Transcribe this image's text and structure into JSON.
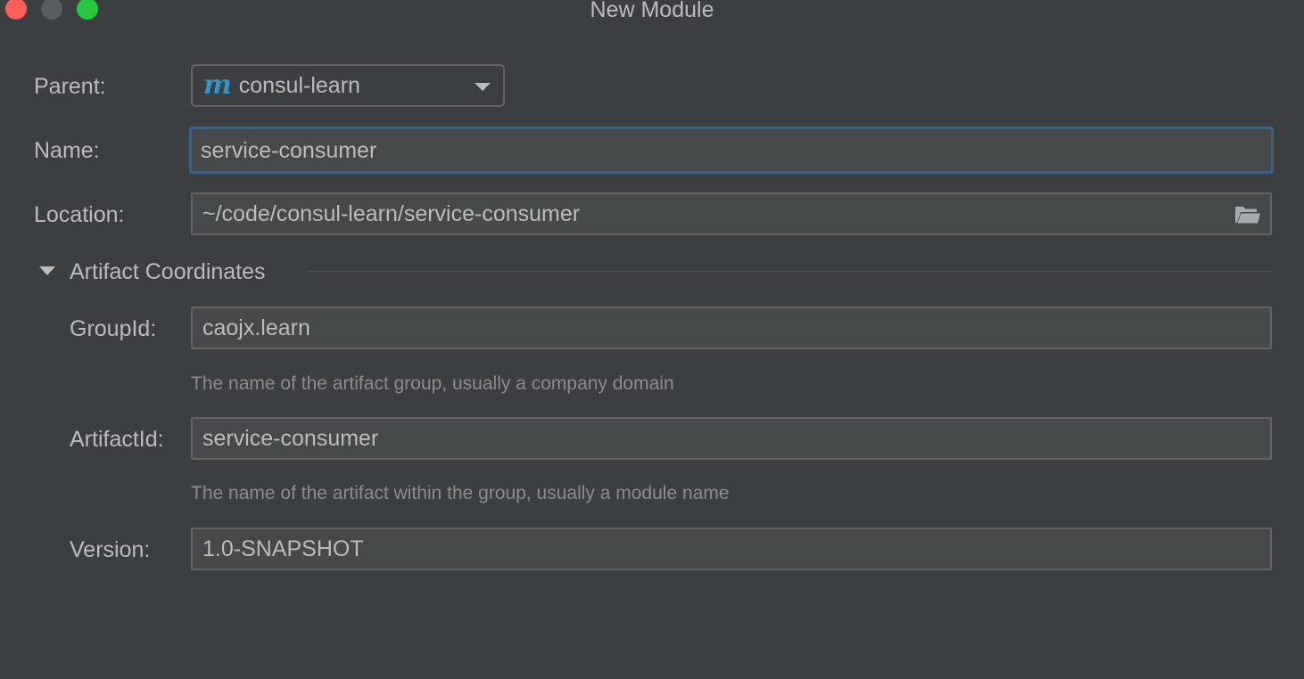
{
  "window": {
    "title": "New Module",
    "colors": {
      "close": "#fe5f57",
      "minimize": "#5a5d5f",
      "zoom": "#28c840",
      "focus_border": "#3d6185",
      "maven_icon": "#3592c4"
    }
  },
  "form": {
    "parent": {
      "label": "Parent:",
      "icon": "maven-module-icon",
      "icon_glyph": "m",
      "value": "consul-learn"
    },
    "name": {
      "label": "Name:",
      "value": "service-consumer"
    },
    "location": {
      "label": "Location:",
      "value": "~/code/consul-learn/service-consumer",
      "icon": "folder-icon"
    }
  },
  "artifact": {
    "section_title": "Artifact Coordinates",
    "expanded": true,
    "group_id": {
      "label": "GroupId:",
      "value": "caojx.learn",
      "hint": "The name of the artifact group, usually a company domain"
    },
    "artifact_id": {
      "label": "ArtifactId:",
      "value": "service-consumer",
      "hint": "The name of the artifact within the group, usually a module name"
    },
    "version": {
      "label": "Version:",
      "value": "1.0-SNAPSHOT"
    }
  }
}
